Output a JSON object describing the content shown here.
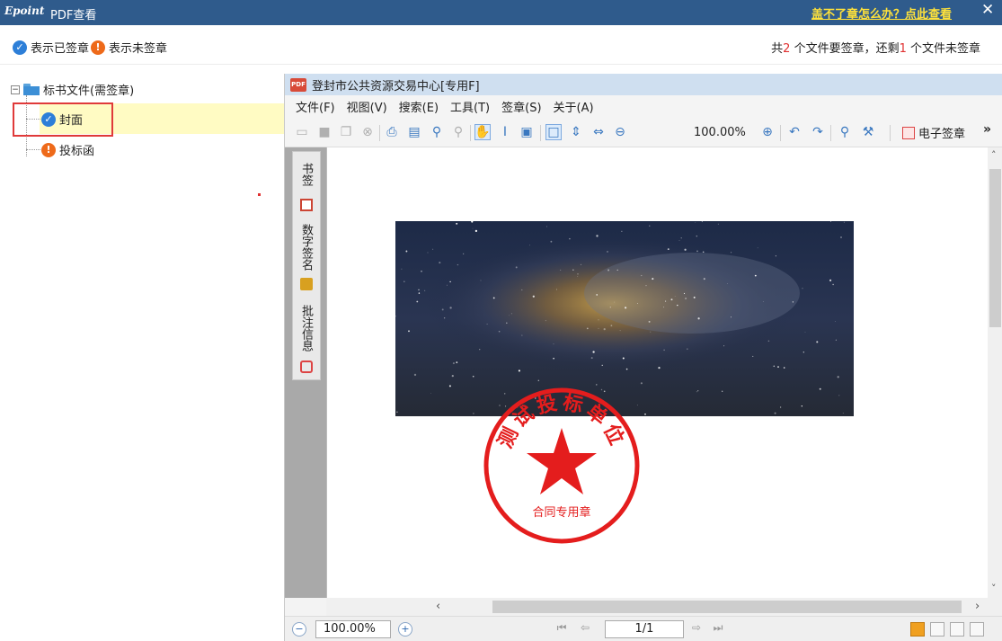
{
  "titlebar": {
    "logo": "Epoint",
    "title": "PDF查看",
    "help_link": "盖不了章怎么办？点此查看",
    "close": "✕"
  },
  "legend": {
    "signed_label": "表示已签章",
    "unsigned_label": "表示未签章",
    "summary": {
      "prefix": "共",
      "total": "2",
      "middle": " 个文件要签章，还剩",
      "remaining": "1",
      "suffix": " 个文件未签章"
    }
  },
  "tree": {
    "root_label": "标书文件(需签章)",
    "items": [
      {
        "label": "封面",
        "status": "signed",
        "selected": true
      },
      {
        "label": "投标函",
        "status": "unsigned",
        "selected": false
      }
    ]
  },
  "viewer": {
    "title": "登封市公共资源交易中心[专用F]",
    "menu": [
      "文件(F)",
      "视图(V)",
      "搜索(E)",
      "工具(T)",
      "签章(S)",
      "关于(A)"
    ],
    "zoom": "100.00%",
    "esign_label": "电子签章",
    "more": "»",
    "side_tabs": [
      "书签",
      "数字签名",
      "批注信息"
    ],
    "stamp": {
      "top_text": "测试投标单位",
      "bottom_text": "合同专用章",
      "color": "#e41d1d"
    },
    "status": {
      "zoom": "100.00%",
      "page": "1/1"
    }
  }
}
